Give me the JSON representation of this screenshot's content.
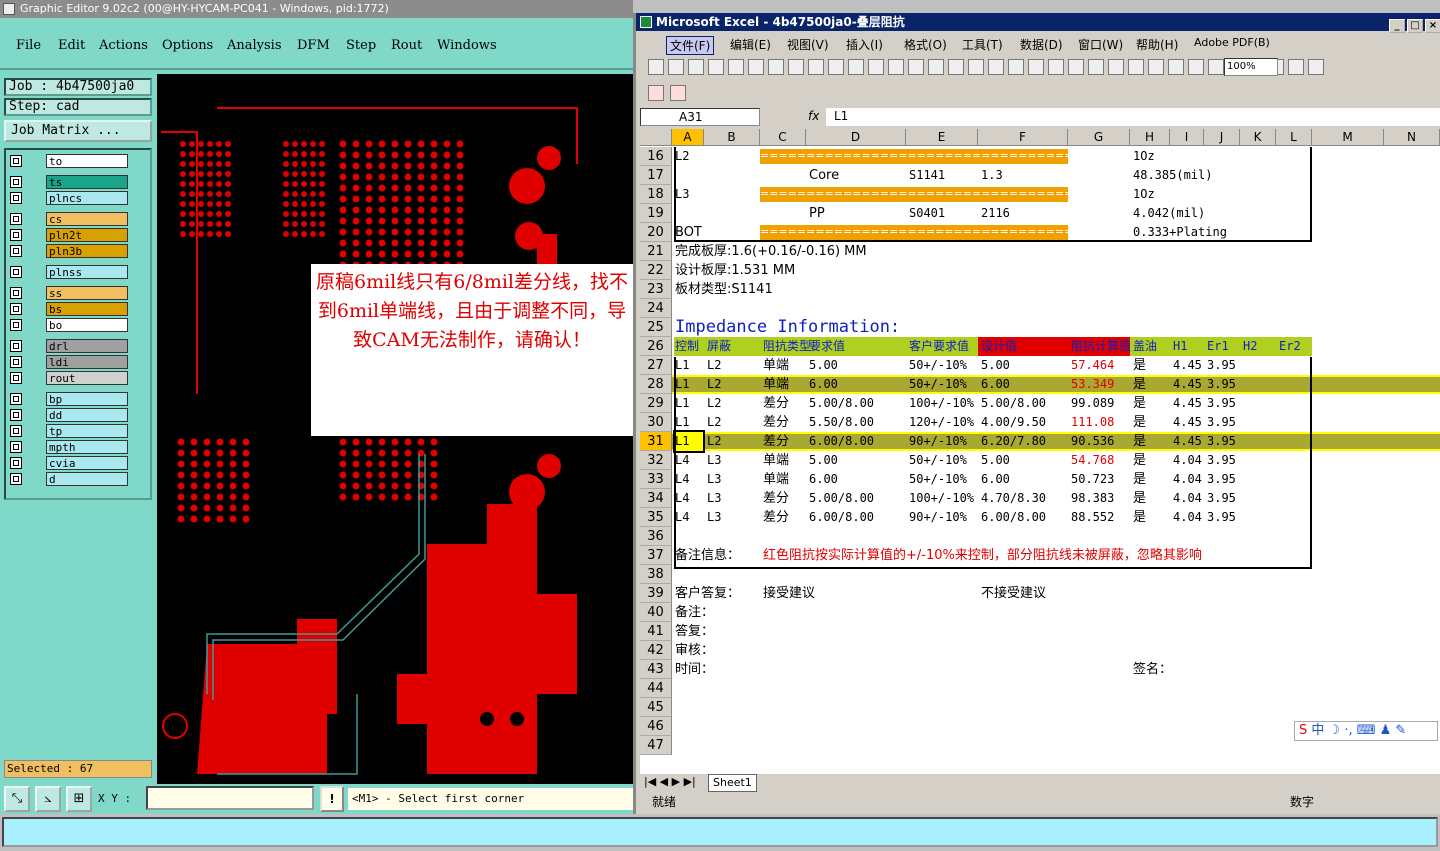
{
  "ge": {
    "title": "Graphic Editor 9.02c2 (00@HY-HYCAM-PC041 - Windows, pid:1772)",
    "menu": [
      "File",
      "Edit",
      "Actions",
      "Options",
      "Analysis",
      "DFM",
      "Step",
      "Rout",
      "Windows"
    ],
    "job": "Job : 4b47500ja0",
    "step": "Step: cad",
    "job_matrix": "Job Matrix ...",
    "layers": [
      {
        "name": "to",
        "color": "#ffffff"
      },
      {
        "name": "ts",
        "color": "#1aa58a"
      },
      {
        "name": "plncs",
        "color": "#a8e8ee"
      },
      {
        "name": "cs",
        "color": "#f0c060"
      },
      {
        "name": "pln2t",
        "color": "#d8a000"
      },
      {
        "name": "pln3b",
        "color": "#d8a000"
      },
      {
        "name": "plnss",
        "color": "#a8e8ee"
      },
      {
        "name": "ss",
        "color": "#f0c060"
      },
      {
        "name": "bs",
        "color": "#d8a000"
      },
      {
        "name": "bo",
        "color": "#ffffff"
      },
      {
        "name": "drl",
        "color": "#a0a0a0"
      },
      {
        "name": "ldi",
        "color": "#a0a0a0"
      },
      {
        "name": "rout",
        "color": "#d0d0d0"
      },
      {
        "name": "bp",
        "color": "#a8e8ee"
      },
      {
        "name": "dd",
        "color": "#a8e8ee"
      },
      {
        "name": "tp",
        "color": "#a8e8ee"
      },
      {
        "name": "mpth",
        "color": "#a8e8ee"
      },
      {
        "name": "cvia",
        "color": "#a8e8ee"
      },
      {
        "name": "d",
        "color": "#a8e8ee"
      }
    ],
    "selected": "Selected : 67",
    "xy_label": "X Y :",
    "msg_btn": "!",
    "message": "<M1> - Select first corner",
    "callout": "原稿6mil线只有6/8mil差分线，找不到6mil单端线，且由于调整不同，导致CAM无法制作，请确认！"
  },
  "xl": {
    "title": "Microsoft Excel - 4b47500ja0-叠层阻抗",
    "menu": [
      "文件(F)",
      "编辑(E)",
      "视图(V)",
      "插入(I)",
      "格式(O)",
      "工具(T)",
      "数据(D)",
      "窗口(W)",
      "帮助(H)",
      "Adobe PDF(B)"
    ],
    "zoom": "100%",
    "namebox": "A31",
    "fx": "fx",
    "formula": "L1",
    "columns": [
      "A",
      "B",
      "C",
      "D",
      "E",
      "F",
      "G",
      "H",
      "I",
      "J",
      "K",
      "L",
      "M",
      "N"
    ],
    "rows": [
      {
        "n": "16",
        "cells": [
          {
            "c": "A",
            "t": "L2"
          },
          {
            "c": "H",
            "t": "1Oz"
          }
        ],
        "bar": true
      },
      {
        "n": "17",
        "cells": [
          {
            "c": "D",
            "t": "Core"
          },
          {
            "c": "E",
            "t": "S1141"
          },
          {
            "c": "F",
            "t": "1.3"
          },
          {
            "c": "H",
            "t": "48.385(mil)"
          }
        ]
      },
      {
        "n": "18",
        "cells": [
          {
            "c": "A",
            "t": "L3"
          },
          {
            "c": "H",
            "t": "1Oz"
          }
        ],
        "bar": true
      },
      {
        "n": "19",
        "cells": [
          {
            "c": "D",
            "t": "PP"
          },
          {
            "c": "E",
            "t": "S0401"
          },
          {
            "c": "F",
            "t": "2116"
          },
          {
            "c": "H",
            "t": "4.042(mil)"
          }
        ]
      },
      {
        "n": "20",
        "cells": [
          {
            "c": "A",
            "t": "BOT"
          },
          {
            "c": "H",
            "t": "0.333+Plating"
          }
        ],
        "bar": true
      },
      {
        "n": "21",
        "cells": [
          {
            "c": "A",
            "t": "完成板厚:1.6(+0.16/-0.16) MM"
          }
        ]
      },
      {
        "n": "22",
        "cells": [
          {
            "c": "A",
            "t": "设计板厚:1.531 MM"
          }
        ]
      },
      {
        "n": "23",
        "cells": [
          {
            "c": "A",
            "t": "板材类型:S1141"
          }
        ]
      },
      {
        "n": "24",
        "cells": []
      },
      {
        "n": "25",
        "cells": [
          {
            "c": "A",
            "t": "Impedance  Information:"
          }
        ]
      },
      {
        "n": "26",
        "cells": [
          {
            "c": "A",
            "t": "控制"
          },
          {
            "c": "B",
            "t": "屏蔽"
          },
          {
            "c": "C",
            "t": "阻抗类型"
          },
          {
            "c": "D",
            "t": "要求值"
          },
          {
            "c": "E",
            "t": "客户要求值"
          },
          {
            "c": "F",
            "t": "设计值"
          },
          {
            "c": "G",
            "t": "阻抗计算值"
          },
          {
            "c": "H",
            "t": "盖油"
          },
          {
            "c": "I",
            "t": "H1"
          },
          {
            "c": "J",
            "t": "Er1"
          },
          {
            "c": "K",
            "t": "H2"
          },
          {
            "c": "L",
            "t": "Er2"
          }
        ]
      },
      {
        "n": "27",
        "cells": [
          {
            "c": "A",
            "t": "L1"
          },
          {
            "c": "B",
            "t": "L2"
          },
          {
            "c": "C",
            "t": "单端"
          },
          {
            "c": "D",
            "t": "5.00"
          },
          {
            "c": "E",
            "t": "50+/-10%"
          },
          {
            "c": "F",
            "t": "5.00"
          },
          {
            "c": "G",
            "t": "57.464",
            "red": true
          },
          {
            "c": "H",
            "t": "是"
          },
          {
            "c": "I",
            "t": "4.45"
          },
          {
            "c": "J",
            "t": "3.95"
          }
        ]
      },
      {
        "n": "28",
        "hl": true,
        "cells": [
          {
            "c": "A",
            "t": "L1"
          },
          {
            "c": "B",
            "t": "L2"
          },
          {
            "c": "C",
            "t": "单端"
          },
          {
            "c": "D",
            "t": "6.00"
          },
          {
            "c": "E",
            "t": "50+/-10%"
          },
          {
            "c": "F",
            "t": "6.00"
          },
          {
            "c": "G",
            "t": "53.349",
            "red": true
          },
          {
            "c": "H",
            "t": "是"
          },
          {
            "c": "I",
            "t": "4.45"
          },
          {
            "c": "J",
            "t": "3.95"
          }
        ]
      },
      {
        "n": "29",
        "cells": [
          {
            "c": "A",
            "t": "L1"
          },
          {
            "c": "B",
            "t": "L2"
          },
          {
            "c": "C",
            "t": "差分"
          },
          {
            "c": "D",
            "t": "5.00/8.00"
          },
          {
            "c": "E",
            "t": "100+/-10%"
          },
          {
            "c": "F",
            "t": "5.00/8.00"
          },
          {
            "c": "G",
            "t": "99.089"
          },
          {
            "c": "H",
            "t": "是"
          },
          {
            "c": "I",
            "t": "4.45"
          },
          {
            "c": "J",
            "t": "3.95"
          }
        ]
      },
      {
        "n": "30",
        "cells": [
          {
            "c": "A",
            "t": "L1"
          },
          {
            "c": "B",
            "t": "L2"
          },
          {
            "c": "C",
            "t": "差分"
          },
          {
            "c": "D",
            "t": "5.50/8.00"
          },
          {
            "c": "E",
            "t": "120+/-10%"
          },
          {
            "c": "F",
            "t": "4.00/9.50"
          },
          {
            "c": "G",
            "t": "111.08",
            "red": true
          },
          {
            "c": "H",
            "t": "是"
          },
          {
            "c": "I",
            "t": "4.45"
          },
          {
            "c": "J",
            "t": "3.95"
          }
        ]
      },
      {
        "n": "31",
        "hl": true,
        "cells": [
          {
            "c": "A",
            "t": "L1"
          },
          {
            "c": "B",
            "t": "L2"
          },
          {
            "c": "C",
            "t": "差分"
          },
          {
            "c": "D",
            "t": "6.00/8.00"
          },
          {
            "c": "E",
            "t": "90+/-10%"
          },
          {
            "c": "F",
            "t": "6.20/7.80"
          },
          {
            "c": "G",
            "t": "90.536"
          },
          {
            "c": "H",
            "t": "是"
          },
          {
            "c": "I",
            "t": "4.45"
          },
          {
            "c": "J",
            "t": "3.95"
          }
        ]
      },
      {
        "n": "32",
        "cells": [
          {
            "c": "A",
            "t": "L4"
          },
          {
            "c": "B",
            "t": "L3"
          },
          {
            "c": "C",
            "t": "单端"
          },
          {
            "c": "D",
            "t": "5.00"
          },
          {
            "c": "E",
            "t": "50+/-10%"
          },
          {
            "c": "F",
            "t": "5.00"
          },
          {
            "c": "G",
            "t": "54.768",
            "red": true
          },
          {
            "c": "H",
            "t": "是"
          },
          {
            "c": "I",
            "t": "4.04"
          },
          {
            "c": "J",
            "t": "3.95"
          }
        ]
      },
      {
        "n": "33",
        "cells": [
          {
            "c": "A",
            "t": "L4"
          },
          {
            "c": "B",
            "t": "L3"
          },
          {
            "c": "C",
            "t": "单端"
          },
          {
            "c": "D",
            "t": "6.00"
          },
          {
            "c": "E",
            "t": "50+/-10%"
          },
          {
            "c": "F",
            "t": "6.00"
          },
          {
            "c": "G",
            "t": "50.723"
          },
          {
            "c": "H",
            "t": "是"
          },
          {
            "c": "I",
            "t": "4.04"
          },
          {
            "c": "J",
            "t": "3.95"
          }
        ]
      },
      {
        "n": "34",
        "cells": [
          {
            "c": "A",
            "t": "L4"
          },
          {
            "c": "B",
            "t": "L3"
          },
          {
            "c": "C",
            "t": "差分"
          },
          {
            "c": "D",
            "t": "5.00/8.00"
          },
          {
            "c": "E",
            "t": "100+/-10%"
          },
          {
            "c": "F",
            "t": "4.70/8.30"
          },
          {
            "c": "G",
            "t": "98.383"
          },
          {
            "c": "H",
            "t": "是"
          },
          {
            "c": "I",
            "t": "4.04"
          },
          {
            "c": "J",
            "t": "3.95"
          }
        ]
      },
      {
        "n": "35",
        "cells": [
          {
            "c": "A",
            "t": "L4"
          },
          {
            "c": "B",
            "t": "L3"
          },
          {
            "c": "C",
            "t": "差分"
          },
          {
            "c": "D",
            "t": "6.00/8.00"
          },
          {
            "c": "E",
            "t": "90+/-10%"
          },
          {
            "c": "F",
            "t": "6.00/8.00"
          },
          {
            "c": "G",
            "t": "88.552"
          },
          {
            "c": "H",
            "t": "是"
          },
          {
            "c": "I",
            "t": "4.04"
          },
          {
            "c": "J",
            "t": "3.95"
          }
        ]
      },
      {
        "n": "36",
        "cells": []
      },
      {
        "n": "37",
        "cells": [
          {
            "c": "A",
            "t": "备注信息："
          },
          {
            "c": "C",
            "t": "红色阻抗按实际计算值的+/-10%来控制，部分阻抗线未被屏蔽，忽略其影响",
            "red": true
          }
        ]
      },
      {
        "n": "38",
        "cells": []
      },
      {
        "n": "39",
        "cells": [
          {
            "c": "A",
            "t": "客户答复："
          },
          {
            "c": "C",
            "t": "接受建议"
          },
          {
            "c": "F",
            "t": "不接受建议"
          }
        ]
      },
      {
        "n": "40",
        "cells": [
          {
            "c": "A",
            "t": "备注："
          }
        ]
      },
      {
        "n": "41",
        "cells": [
          {
            "c": "A",
            "t": "答复："
          }
        ]
      },
      {
        "n": "42",
        "cells": [
          {
            "c": "A",
            "t": "审核："
          }
        ]
      },
      {
        "n": "43",
        "cells": [
          {
            "c": "A",
            "t": "时间："
          },
          {
            "c": "H",
            "t": "签名："
          }
        ]
      },
      {
        "n": "44",
        "cells": []
      },
      {
        "n": "45",
        "cells": []
      },
      {
        "n": "46",
        "cells": []
      },
      {
        "n": "47",
        "cells": []
      }
    ],
    "sheet_tab": "Sheet1",
    "status_left": "就绪",
    "status_right": "数字",
    "ime": [
      "中"
    ]
  }
}
